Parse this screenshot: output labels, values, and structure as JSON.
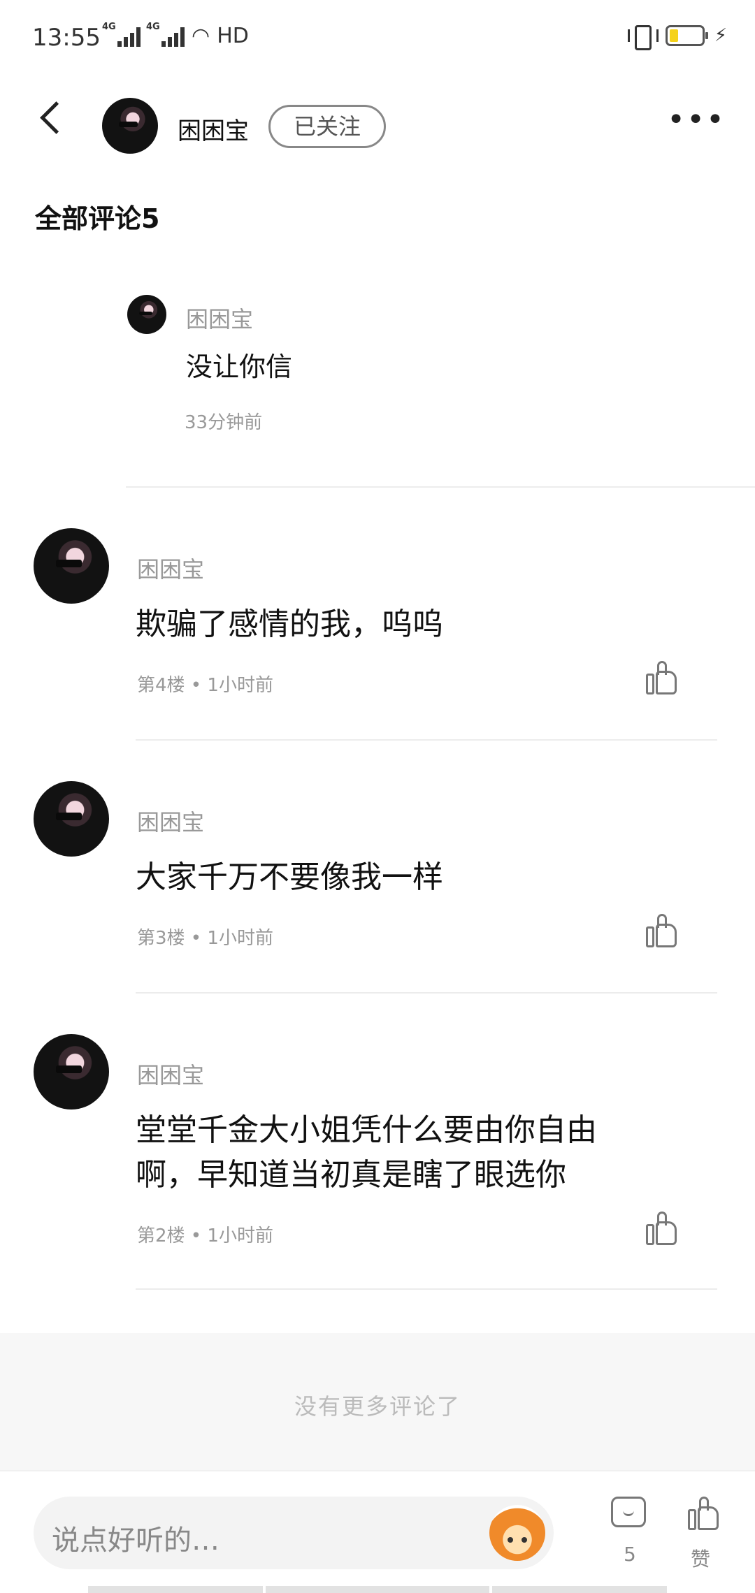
{
  "status_bar": {
    "time": "13:55",
    "network_1": "4G",
    "network_2": "4G",
    "hd": "HD"
  },
  "header": {
    "author_name": "困困宝",
    "follow_label": "已关注"
  },
  "comments_title": "全部评论5",
  "reply": {
    "name": "困困宝",
    "text": "没让你信",
    "time": "33分钟前"
  },
  "comments": [
    {
      "name": "困困宝",
      "text": "欺骗了感情的我，呜呜",
      "meta": "第4楼 • 1小时前"
    },
    {
      "name": "困困宝",
      "text": "大家千万不要像我一样",
      "meta": "第3楼 • 1小时前"
    },
    {
      "name": "困困宝",
      "text": "堂堂千金大小姐凭什么要由你自由啊，早知道当初真是瞎了眼选你",
      "meta": "第2楼 • 1小时前"
    }
  ],
  "no_more_text": "没有更多评论了",
  "bottom_bar": {
    "input_placeholder": "说点好听的…",
    "comment_count": "5",
    "like_label": "赞"
  }
}
